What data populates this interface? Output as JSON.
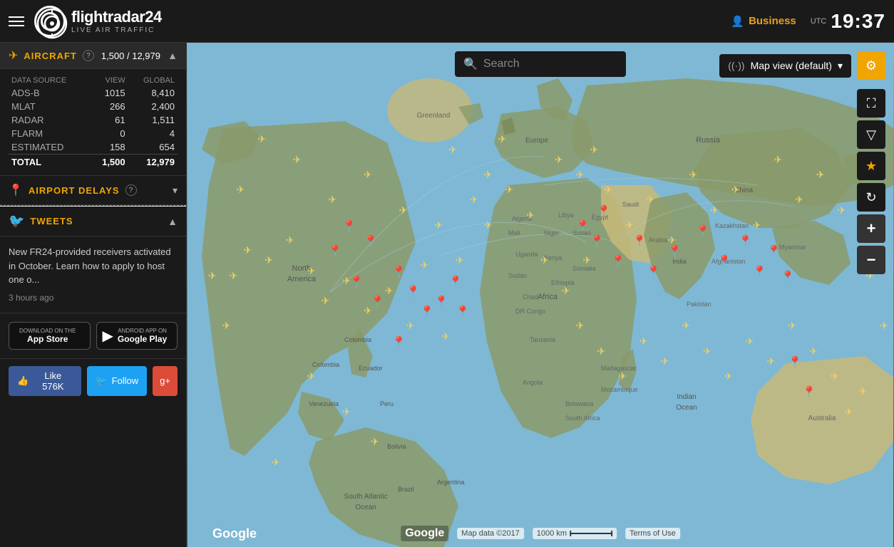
{
  "header": {
    "logo_name": "flightradar24",
    "logo_sub": "LIVE AIR TRAFFIC",
    "business_label": "Business",
    "utc_label": "UTC",
    "time": "19:37"
  },
  "sidebar": {
    "aircraft_label": "AIRCRAFT",
    "aircraft_count": "1,500 / 12,979",
    "table": {
      "headers": [
        "DATA SOURCE",
        "VIEW",
        "GLOBAL"
      ],
      "rows": [
        {
          "source": "ADS-B",
          "view": "1015",
          "global": "8,410"
        },
        {
          "source": "MLAT",
          "view": "266",
          "global": "2,400"
        },
        {
          "source": "RADAR",
          "view": "61",
          "global": "1,511"
        },
        {
          "source": "FLARM",
          "view": "0",
          "global": "4"
        },
        {
          "source": "ESTIMATED",
          "view": "158",
          "global": "654"
        }
      ],
      "total_label": "TOTAL",
      "total_view": "1,500",
      "total_global": "12,979"
    },
    "airport_delays_label": "AIRPORT DELAYS",
    "tweets_label": "TWEETS",
    "tweet_text": "New FR24-provided receivers activated in October. Learn how to apply to host one o...",
    "tweet_time": "3 hours ago",
    "app_store_sub": "Download on the",
    "app_store_name": "App Store",
    "google_play_sub": "ANDROID APP ON",
    "google_play_name": "Google Play",
    "fb_like": "Like 576K",
    "tw_follow": "Follow",
    "gp_plus": "g+"
  },
  "map": {
    "search_placeholder": "Search",
    "view_label": "Map view (default)",
    "map_data": "Map data ©2017",
    "scale": "1000 km",
    "terms": "Terms of Use"
  }
}
